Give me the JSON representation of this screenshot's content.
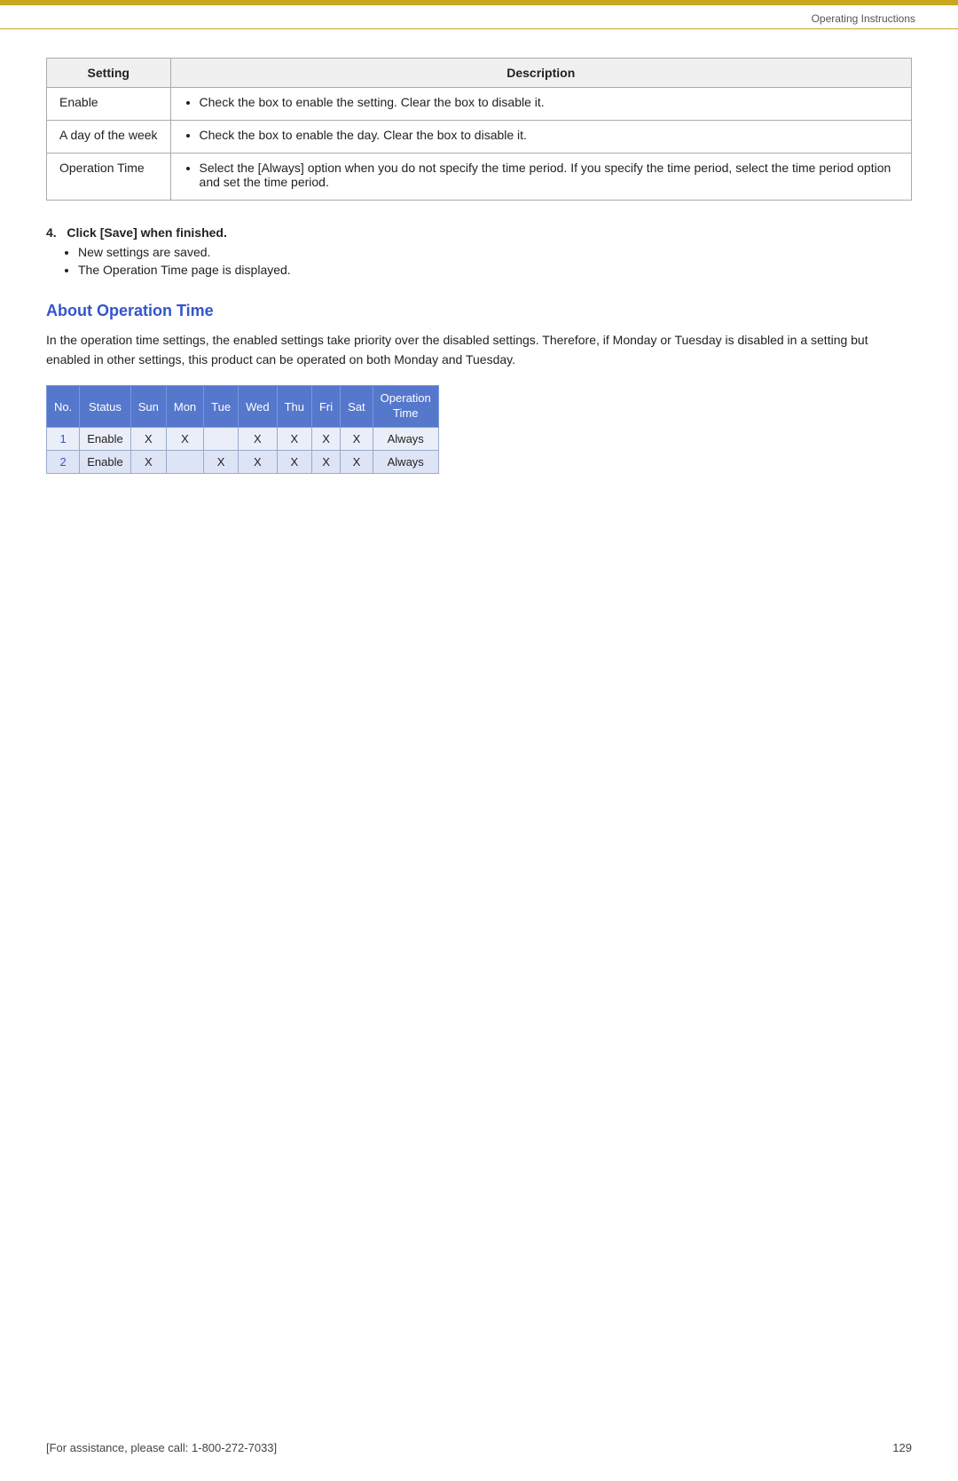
{
  "header": {
    "title": "Operating Instructions"
  },
  "settings_table": {
    "col1_header": "Setting",
    "col2_header": "Description",
    "rows": [
      {
        "setting": "Enable",
        "description": "Check the box to enable the setting. Clear the box to disable it."
      },
      {
        "setting": "A day of the week",
        "description": "Check the box to enable the day. Clear the box to disable it."
      },
      {
        "setting": "Operation Time",
        "description": "Select the [Always] option when you do not specify the time period. If you specify the time period, select the time period option and set the time period."
      }
    ]
  },
  "step4": {
    "label": "4.",
    "instruction": "Click [Save] when finished.",
    "bullets": [
      "New settings are saved.",
      "The Operation Time page is displayed."
    ]
  },
  "about_section": {
    "heading": "About Operation Time",
    "paragraph": "In the operation time settings, the enabled settings take priority over the disabled settings. Therefore, if Monday or Tuesday is disabled in a setting but enabled in other settings, this product can be operated on both Monday and Tuesday."
  },
  "op_table": {
    "headers": [
      "No.",
      "Status",
      "Sun",
      "Mon",
      "Tue",
      "Wed",
      "Thu",
      "Fri",
      "Sat",
      "Operation\nTime"
    ],
    "rows": [
      {
        "no": "1",
        "status": "Enable",
        "sun": "X",
        "mon": "X",
        "tue": "",
        "wed": "X",
        "thu": "X",
        "fri": "X",
        "sat": "X",
        "operation_time": "Always"
      },
      {
        "no": "2",
        "status": "Enable",
        "sun": "X",
        "mon": "",
        "tue": "X",
        "wed": "X",
        "thu": "X",
        "fri": "X",
        "sat": "X",
        "operation_time": "Always"
      }
    ]
  },
  "footer": {
    "assistance": "[For assistance, please call: 1-800-272-7033]",
    "page_number": "129"
  }
}
